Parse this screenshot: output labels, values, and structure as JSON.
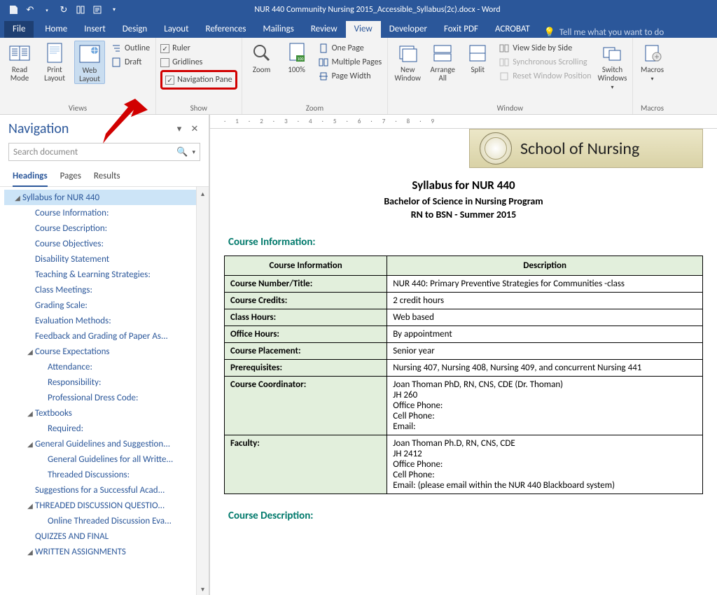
{
  "app": {
    "title": "NUR 440 Community Nursing 2015_Accessible_Syllabus(2c).docx - Word"
  },
  "tabs": {
    "file": "File",
    "home": "Home",
    "insert": "Insert",
    "design": "Design",
    "layout": "Layout",
    "references": "References",
    "mailings": "Mailings",
    "review": "Review",
    "view": "View",
    "developer": "Developer",
    "foxit": "Foxit PDF",
    "acrobat": "ACROBAT",
    "tellme": "Tell me what you want to do"
  },
  "ribbon": {
    "views_group": "Views",
    "read_mode": "Read Mode",
    "print_layout": "Print Layout",
    "web_layout": "Web Layout",
    "outline": "Outline",
    "draft": "Draft",
    "show_group": "Show",
    "ruler": "Ruler",
    "gridlines": "Gridlines",
    "navigation_pane": "Navigation Pane",
    "zoom_group": "Zoom",
    "zoom": "Zoom",
    "pct100": "100%",
    "one_page": "One Page",
    "multiple_pages": "Multiple Pages",
    "page_width": "Page Width",
    "window_group": "Window",
    "new_window": "New Window",
    "arrange_all": "Arrange All",
    "split": "Split",
    "side_by_side": "View Side by Side",
    "sync_scroll": "Synchronous Scrolling",
    "reset_pos": "Reset Window Position",
    "switch_windows": "Switch Windows",
    "macros_group": "Macros",
    "macros": "Macros"
  },
  "nav": {
    "title": "Navigation",
    "search_placeholder": "Search document",
    "tabs": {
      "headings": "Headings",
      "pages": "Pages",
      "results": "Results"
    },
    "tree": [
      {
        "level": 0,
        "label": "Syllabus for NUR 440",
        "expanded": true,
        "selected": true
      },
      {
        "level": 1,
        "label": "Course Information:"
      },
      {
        "level": 1,
        "label": "Course Description:"
      },
      {
        "level": 1,
        "label": "Course Objectives:"
      },
      {
        "level": 1,
        "label": "Disability Statement"
      },
      {
        "level": 1,
        "label": "Teaching & Learning Strategies:"
      },
      {
        "level": 1,
        "label": "Class Meetings:"
      },
      {
        "level": 1,
        "label": "Grading Scale:"
      },
      {
        "level": 1,
        "label": "Evaluation Methods:"
      },
      {
        "level": 1,
        "label": "Feedback and Grading of Paper As..."
      },
      {
        "level": 1,
        "label": "Course Expectations",
        "expanded": true
      },
      {
        "level": 2,
        "label": "Attendance:"
      },
      {
        "level": 2,
        "label": "Responsibility:"
      },
      {
        "level": 2,
        "label": "Professional Dress Code:"
      },
      {
        "level": 1,
        "label": "Textbooks",
        "expanded": true
      },
      {
        "level": 2,
        "label": "Required:"
      },
      {
        "level": 1,
        "label": "General Guidelines and Suggestion...",
        "expanded": true
      },
      {
        "level": 2,
        "label": "General Guidelines for all Writte..."
      },
      {
        "level": 2,
        "label": "Threaded Discussions:"
      },
      {
        "level": 1,
        "label": "Suggestions for a Successful Acad..."
      },
      {
        "level": 1,
        "label": "THREADED DISCUSSION QUESTIO...",
        "expanded": true
      },
      {
        "level": 2,
        "label": "Online Threaded Discussion Eva..."
      },
      {
        "level": 1,
        "label": "QUIZZES AND FINAL"
      },
      {
        "level": 1,
        "label": "WRITTEN ASSIGNMENTS",
        "expanded": true
      }
    ]
  },
  "doc": {
    "banner": "School of Nursing",
    "h1": "Syllabus for NUR 440",
    "h2": "Bachelor of Science in Nursing Program",
    "h3": "RN to BSN  -  Summer 2015",
    "section1": "Course Information:",
    "th1": "Course Information",
    "th2": "Description",
    "rows": [
      {
        "k": "Course Number/Title:",
        "v": "NUR 440: Primary Preventive Strategies for Communities -class"
      },
      {
        "k": "Course Credits:",
        "v": "2 credit hours"
      },
      {
        "k": "Class Hours:",
        "v": "Web based"
      },
      {
        "k": "Office Hours:",
        "v": "By appointment"
      },
      {
        "k": "Course Placement:",
        "v": "Senior year"
      },
      {
        "k": "Prerequisites:",
        "v": "Nursing 407, Nursing 408, Nursing 409, and concurrent Nursing 441"
      },
      {
        "k": "Course Coordinator:",
        "v": "Joan Thoman PhD, RN, CNS, CDE (Dr. Thoman)\nJH 260\nOffice Phone:\nCell Phone:\nEmail:"
      },
      {
        "k": "Faculty:",
        "v": "Joan Thoman Ph.D, RN, CNS, CDE\nJH 2412\nOffice Phone:\nCell Phone:\nEmail:                               (please email within the NUR 440 Blackboard system)"
      }
    ],
    "section2": "Course Description:"
  }
}
